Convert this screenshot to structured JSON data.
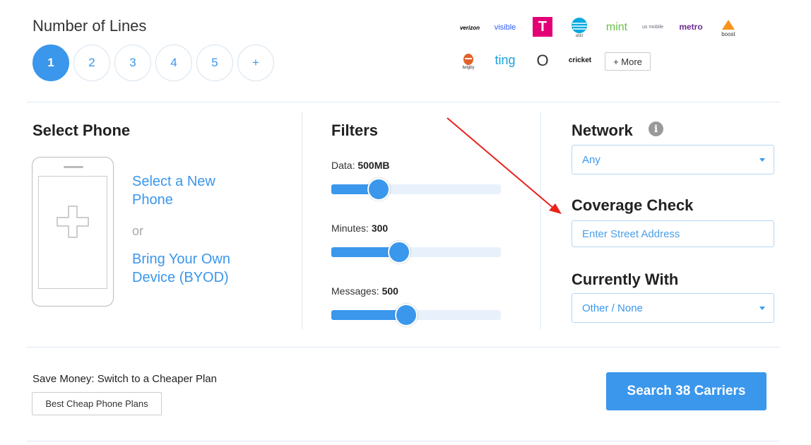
{
  "lines": {
    "title": "Number of Lines",
    "options": [
      "1",
      "2",
      "3",
      "4",
      "5",
      "+"
    ],
    "selected": "1"
  },
  "carriers": {
    "logos": [
      "verizon",
      "visible",
      "T",
      "at&t",
      "mint",
      "us mobile",
      "metro",
      "boost",
      "twigby",
      "ting",
      "O",
      "cricket"
    ],
    "more_label": "+ More",
    "colors": {
      "tmobile": "#e20074",
      "att": "#00a8e0",
      "mint": "#6cc04a",
      "metro": "#6b2c91",
      "boost": "#f7941d",
      "ting": "#1aa0e0",
      "visible": "#2e5bff"
    }
  },
  "select_phone": {
    "title": "Select Phone",
    "new_phone_link": "Select a New Phone",
    "or_label": "or",
    "byod_link": "Bring Your Own Device (BYOD)"
  },
  "filters": {
    "title": "Filters",
    "data": {
      "label": "Data:",
      "value": "500MB",
      "level": 0.28
    },
    "minutes": {
      "label": "Minutes:",
      "value": "300",
      "level": 0.4
    },
    "messages": {
      "label": "Messages:",
      "value": "500",
      "level": 0.44
    }
  },
  "network": {
    "title": "Network",
    "selected": "Any"
  },
  "coverage": {
    "title": "Coverage Check",
    "placeholder": "Enter Street Address"
  },
  "currently_with": {
    "title": "Currently With",
    "selected": "Other / None"
  },
  "footer": {
    "save_text": "Save Money: Switch to a Cheaper Plan",
    "cheap_plans_button": "Best Cheap Phone Plans",
    "search_button": "Search 38 Carriers"
  },
  "accent_color": "#3a97ec",
  "annotation_color": "#e8231d"
}
